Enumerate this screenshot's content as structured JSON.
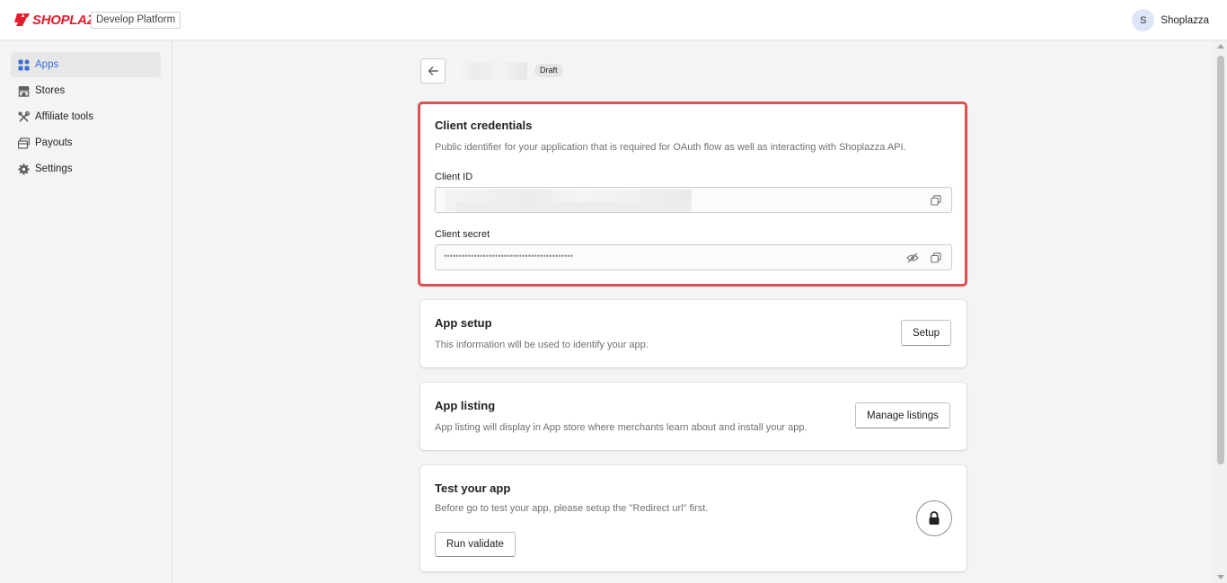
{
  "header": {
    "logo_text": "SHOPLAZZA",
    "platform_label": "Develop Platform",
    "user": {
      "avatar_initial": "S",
      "name": "Shoplazza"
    }
  },
  "sidebar": {
    "items": [
      {
        "label": "Apps",
        "icon": "apps-icon",
        "active": true
      },
      {
        "label": "Stores",
        "icon": "store-icon",
        "active": false
      },
      {
        "label": "Affiliate tools",
        "icon": "tools-icon",
        "active": false
      },
      {
        "label": "Payouts",
        "icon": "payouts-icon",
        "active": false
      },
      {
        "label": "Settings",
        "icon": "gear-icon",
        "active": false
      }
    ]
  },
  "page": {
    "status_badge": "Draft"
  },
  "credentials": {
    "title": "Client credentials",
    "description": "Public identifier for your application that is required for OAuth flow as well as interacting with Shoplazza API.",
    "client_id_label": "Client ID",
    "client_secret_label": "Client secret",
    "client_secret_masked": "•••••••••••••••••••••••••••••••••••••••••••"
  },
  "app_setup": {
    "title": "App setup",
    "description": "This information will be used to identify your app.",
    "button": "Setup"
  },
  "app_listing": {
    "title": "App listing",
    "description": "App listing will display in App store where merchants learn about and install your app.",
    "button": "Manage listings"
  },
  "test_app": {
    "title": "Test your app",
    "description": "Before go to test your app, please setup the \"Redirect url\" first.",
    "button": "Run validate"
  },
  "colors": {
    "brand": "#e31d2b",
    "active_nav": "#3b6dd8",
    "highlight": "#e05050"
  }
}
